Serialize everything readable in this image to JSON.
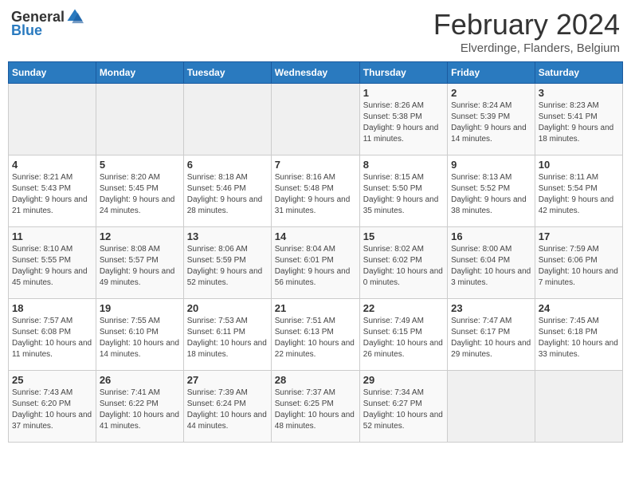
{
  "header": {
    "logo_general": "General",
    "logo_blue": "Blue",
    "month_title": "February 2024",
    "subtitle": "Elverdinge, Flanders, Belgium"
  },
  "weekdays": [
    "Sunday",
    "Monday",
    "Tuesday",
    "Wednesday",
    "Thursday",
    "Friday",
    "Saturday"
  ],
  "weeks": [
    [
      {
        "day": "",
        "info": ""
      },
      {
        "day": "",
        "info": ""
      },
      {
        "day": "",
        "info": ""
      },
      {
        "day": "",
        "info": ""
      },
      {
        "day": "1",
        "info": "Sunrise: 8:26 AM\nSunset: 5:38 PM\nDaylight: 9 hours\nand 11 minutes."
      },
      {
        "day": "2",
        "info": "Sunrise: 8:24 AM\nSunset: 5:39 PM\nDaylight: 9 hours\nand 14 minutes."
      },
      {
        "day": "3",
        "info": "Sunrise: 8:23 AM\nSunset: 5:41 PM\nDaylight: 9 hours\nand 18 minutes."
      }
    ],
    [
      {
        "day": "4",
        "info": "Sunrise: 8:21 AM\nSunset: 5:43 PM\nDaylight: 9 hours\nand 21 minutes."
      },
      {
        "day": "5",
        "info": "Sunrise: 8:20 AM\nSunset: 5:45 PM\nDaylight: 9 hours\nand 24 minutes."
      },
      {
        "day": "6",
        "info": "Sunrise: 8:18 AM\nSunset: 5:46 PM\nDaylight: 9 hours\nand 28 minutes."
      },
      {
        "day": "7",
        "info": "Sunrise: 8:16 AM\nSunset: 5:48 PM\nDaylight: 9 hours\nand 31 minutes."
      },
      {
        "day": "8",
        "info": "Sunrise: 8:15 AM\nSunset: 5:50 PM\nDaylight: 9 hours\nand 35 minutes."
      },
      {
        "day": "9",
        "info": "Sunrise: 8:13 AM\nSunset: 5:52 PM\nDaylight: 9 hours\nand 38 minutes."
      },
      {
        "day": "10",
        "info": "Sunrise: 8:11 AM\nSunset: 5:54 PM\nDaylight: 9 hours\nand 42 minutes."
      }
    ],
    [
      {
        "day": "11",
        "info": "Sunrise: 8:10 AM\nSunset: 5:55 PM\nDaylight: 9 hours\nand 45 minutes."
      },
      {
        "day": "12",
        "info": "Sunrise: 8:08 AM\nSunset: 5:57 PM\nDaylight: 9 hours\nand 49 minutes."
      },
      {
        "day": "13",
        "info": "Sunrise: 8:06 AM\nSunset: 5:59 PM\nDaylight: 9 hours\nand 52 minutes."
      },
      {
        "day": "14",
        "info": "Sunrise: 8:04 AM\nSunset: 6:01 PM\nDaylight: 9 hours\nand 56 minutes."
      },
      {
        "day": "15",
        "info": "Sunrise: 8:02 AM\nSunset: 6:02 PM\nDaylight: 10 hours\nand 0 minutes."
      },
      {
        "day": "16",
        "info": "Sunrise: 8:00 AM\nSunset: 6:04 PM\nDaylight: 10 hours\nand 3 minutes."
      },
      {
        "day": "17",
        "info": "Sunrise: 7:59 AM\nSunset: 6:06 PM\nDaylight: 10 hours\nand 7 minutes."
      }
    ],
    [
      {
        "day": "18",
        "info": "Sunrise: 7:57 AM\nSunset: 6:08 PM\nDaylight: 10 hours\nand 11 minutes."
      },
      {
        "day": "19",
        "info": "Sunrise: 7:55 AM\nSunset: 6:10 PM\nDaylight: 10 hours\nand 14 minutes."
      },
      {
        "day": "20",
        "info": "Sunrise: 7:53 AM\nSunset: 6:11 PM\nDaylight: 10 hours\nand 18 minutes."
      },
      {
        "day": "21",
        "info": "Sunrise: 7:51 AM\nSunset: 6:13 PM\nDaylight: 10 hours\nand 22 minutes."
      },
      {
        "day": "22",
        "info": "Sunrise: 7:49 AM\nSunset: 6:15 PM\nDaylight: 10 hours\nand 26 minutes."
      },
      {
        "day": "23",
        "info": "Sunrise: 7:47 AM\nSunset: 6:17 PM\nDaylight: 10 hours\nand 29 minutes."
      },
      {
        "day": "24",
        "info": "Sunrise: 7:45 AM\nSunset: 6:18 PM\nDaylight: 10 hours\nand 33 minutes."
      }
    ],
    [
      {
        "day": "25",
        "info": "Sunrise: 7:43 AM\nSunset: 6:20 PM\nDaylight: 10 hours\nand 37 minutes."
      },
      {
        "day": "26",
        "info": "Sunrise: 7:41 AM\nSunset: 6:22 PM\nDaylight: 10 hours\nand 41 minutes."
      },
      {
        "day": "27",
        "info": "Sunrise: 7:39 AM\nSunset: 6:24 PM\nDaylight: 10 hours\nand 44 minutes."
      },
      {
        "day": "28",
        "info": "Sunrise: 7:37 AM\nSunset: 6:25 PM\nDaylight: 10 hours\nand 48 minutes."
      },
      {
        "day": "29",
        "info": "Sunrise: 7:34 AM\nSunset: 6:27 PM\nDaylight: 10 hours\nand 52 minutes."
      },
      {
        "day": "",
        "info": ""
      },
      {
        "day": "",
        "info": ""
      }
    ]
  ]
}
